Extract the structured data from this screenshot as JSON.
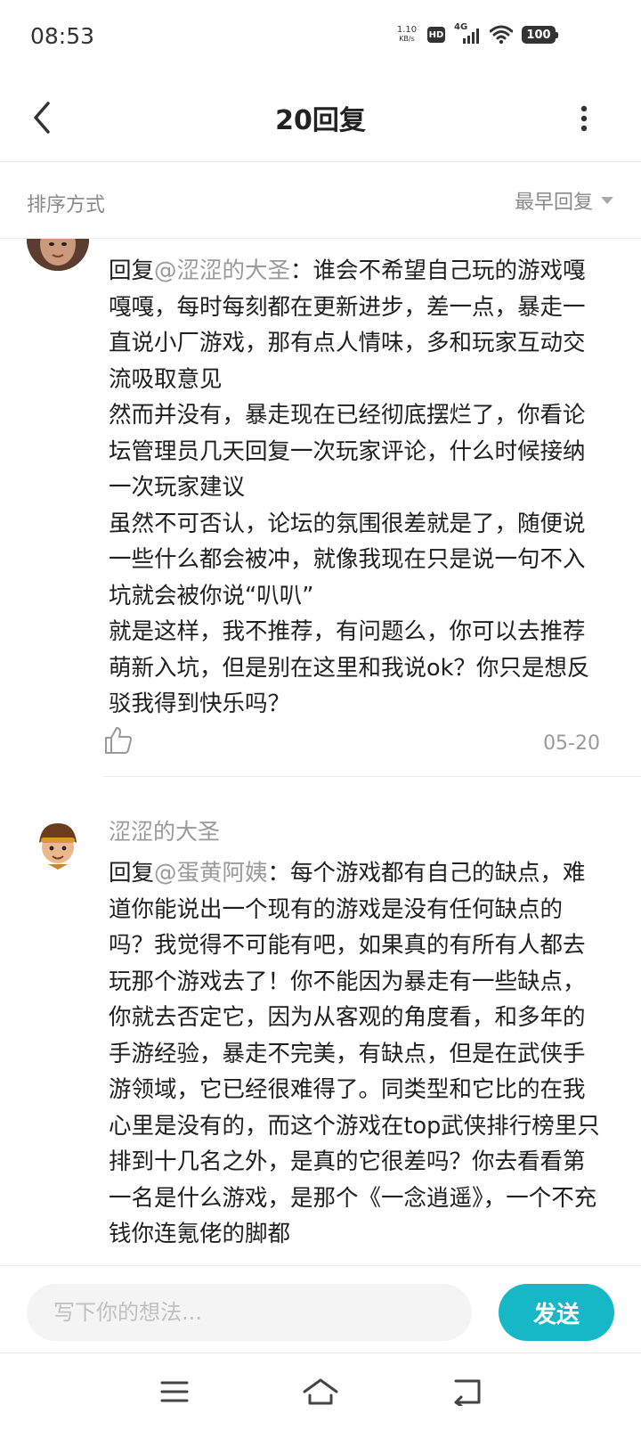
{
  "status_bar": {
    "time": "08:53",
    "net_speed_value": "1.10",
    "net_speed_unit": "KB/s",
    "hd_label": "HD",
    "network_label": "4G",
    "battery_level": "100"
  },
  "header": {
    "title": "20回复"
  },
  "sort_bar": {
    "label": "排序方式",
    "selected": "最早回复"
  },
  "comments": [
    {
      "reply_prefix": "回复",
      "mention": "@涩涩的大圣",
      "text": "：谁会不希望自己玩的游戏嘎嘎嘎，每时每刻都在更新进步，差一点，暴走一直说小厂游戏，那有点人情味，多和玩家互动交流吸取意见\n然而并没有，暴走现在已经彻底摆烂了，你看论坛管理员几天回复一次玩家评论，什么时候接纳一次玩家建议\n虽然不可否认，论坛的氛围很差就是了，随便说一些什么都会被冲，就像我现在只是说一句不入坑就会被你说“叭叭”\n就是这样，我不推荐，有问题么，你可以去推荐萌新入坑，但是别在这里和我说ok？你只是想反驳我得到快乐吗？",
      "date": "05-20"
    },
    {
      "username": "涩涩的大圣",
      "reply_prefix": "回复",
      "mention": "@蛋黄阿姨",
      "text": "：每个游戏都有自己的缺点，难道你能说出一个现有的游戏是没有任何缺点的吗？我觉得不可能有吧，如果真的有所有人都去玩那个游戏去了！你不能因为暴走有一些缺点，你就去否定它，因为从客观的角度看，和多年的手游经验，暴走不完美，有缺点，但是在武侠手游领域，它已经很难得了。同类型和它比的在我心里是没有的，而这个游戏在top武侠排行榜里只排到十几名之外，是真的它很差吗？你去看看第一名是什么游戏，是那个《一念逍遥》，一个不充钱你连氪佬的脚都"
    }
  ],
  "composer": {
    "placeholder": "写下你的想法...",
    "send_label": "发送"
  },
  "colors": {
    "accent": "#16b8c8",
    "muted_text": "#9a9a9a"
  },
  "icons": [
    "back-arrow-icon",
    "more-vertical-icon",
    "triangle-down-icon",
    "thumbs-up-icon",
    "menu-icon",
    "home-icon",
    "back-nav-icon"
  ]
}
